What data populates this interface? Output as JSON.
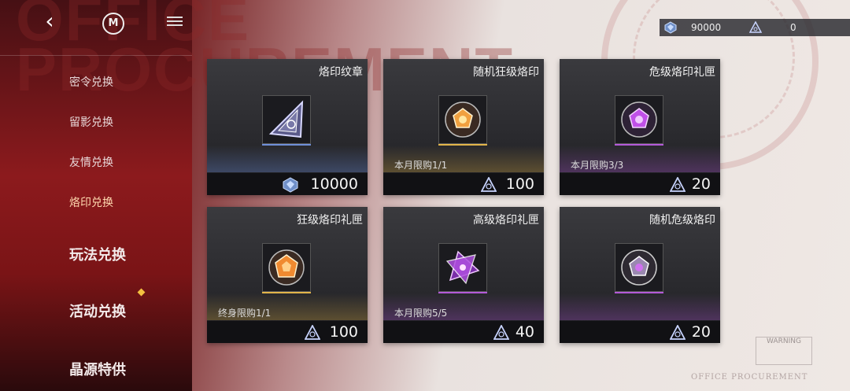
{
  "background": {
    "deco_line1": "OFFICE",
    "deco_line2": "PROCUREMENT",
    "footer_text": "OFFICE PROCUREMENT",
    "warning_text": "WARNING",
    "accent_red": "#8c1a1d"
  },
  "topbar": {
    "back_icon": "back-chevron-icon",
    "logo_letter": "M",
    "menu_icon": "menu-icon"
  },
  "currency": {
    "crystal": {
      "icon": "crystal-icon",
      "value": "90000"
    },
    "seal_token": {
      "icon": "seal-token-icon",
      "value": "0"
    }
  },
  "sidebar": {
    "items": [
      {
        "label": "密令兑换"
      },
      {
        "label": "留影兑换"
      },
      {
        "label": "友情兑换"
      },
      {
        "label": "烙印兑换"
      },
      {
        "label": "玩法兑换"
      },
      {
        "label": "活动兑换"
      },
      {
        "label": "晶源特供"
      }
    ],
    "active_index": 3
  },
  "cards": [
    {
      "title": "烙印纹章",
      "limit": "",
      "price": "10000",
      "currency": "crystal-icon",
      "rarity_color": "#6f8fd8"
    },
    {
      "title": "随机狂级烙印",
      "limit": "本月限购1/1",
      "price": "100",
      "currency": "seal-token-icon",
      "rarity_color": "#e2b44a"
    },
    {
      "title": "危级烙印礼匣",
      "limit": "本月限购3/3",
      "price": "20",
      "currency": "seal-token-icon",
      "rarity_color": "#b35ad8"
    },
    {
      "title": "狂级烙印礼匣",
      "limit": "终身限购1/1",
      "price": "100",
      "currency": "seal-token-icon",
      "rarity_color": "#e2b44a"
    },
    {
      "title": "高级烙印礼匣",
      "limit": "本月限购5/5",
      "price": "40",
      "currency": "seal-token-icon",
      "rarity_color": "#b35ad8"
    },
    {
      "title": "随机危级烙印",
      "limit": "",
      "price": "20",
      "currency": "seal-token-icon",
      "rarity_color": "#b35ad8"
    }
  ]
}
